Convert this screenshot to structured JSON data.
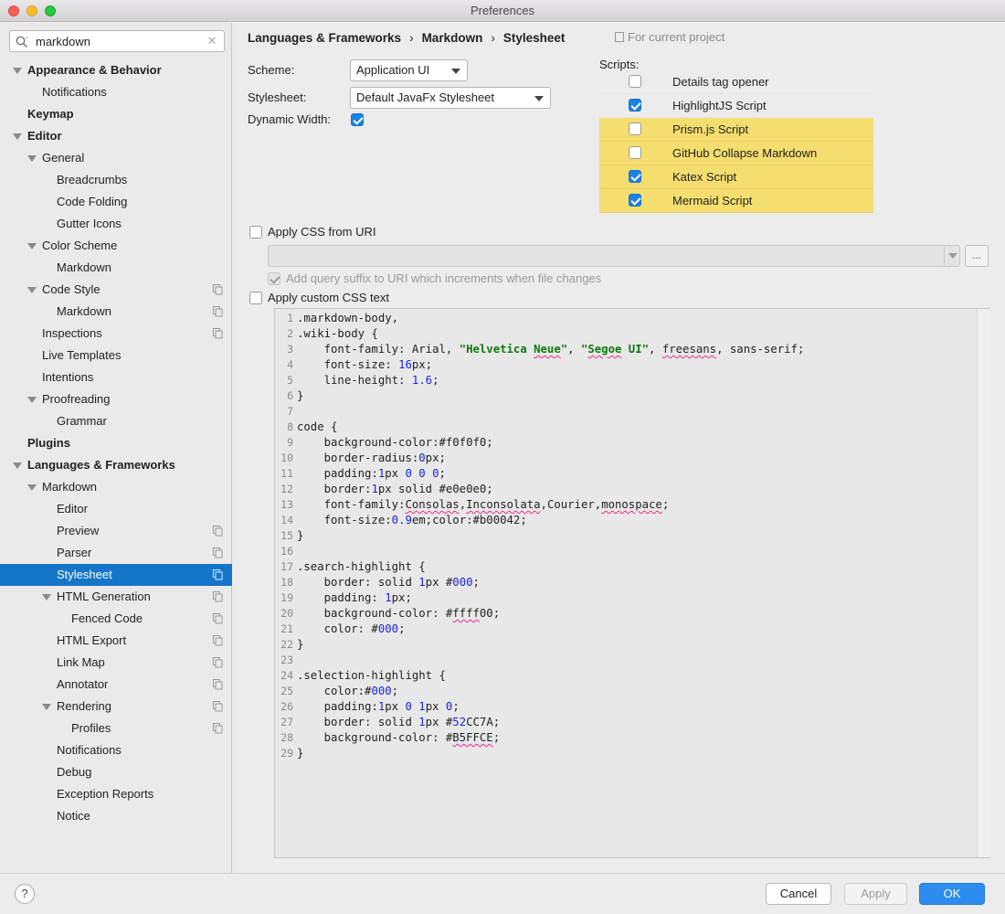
{
  "window": {
    "title": "Preferences"
  },
  "search": {
    "value": "markdown",
    "placeholder": ""
  },
  "sidebar": {
    "items": [
      {
        "label": "Appearance & Behavior",
        "level": 0,
        "bold": true,
        "expanded": true,
        "copy": false
      },
      {
        "label": "Notifications",
        "level": 1,
        "bold": false,
        "copy": false
      },
      {
        "label": "Keymap",
        "level": 0,
        "bold": true,
        "copy": false
      },
      {
        "label": "Editor",
        "level": 0,
        "bold": true,
        "expanded": true,
        "copy": false
      },
      {
        "label": "General",
        "level": 1,
        "bold": false,
        "expanded": true,
        "copy": false
      },
      {
        "label": "Breadcrumbs",
        "level": 2,
        "bold": false,
        "copy": false
      },
      {
        "label": "Code Folding",
        "level": 2,
        "bold": false,
        "copy": false
      },
      {
        "label": "Gutter Icons",
        "level": 2,
        "bold": false,
        "copy": false
      },
      {
        "label": "Color Scheme",
        "level": 1,
        "bold": false,
        "expanded": true,
        "copy": false
      },
      {
        "label": "Markdown",
        "level": 2,
        "bold": false,
        "copy": false
      },
      {
        "label": "Code Style",
        "level": 1,
        "bold": false,
        "expanded": true,
        "copy": true
      },
      {
        "label": "Markdown",
        "level": 2,
        "bold": false,
        "copy": true
      },
      {
        "label": "Inspections",
        "level": 1,
        "bold": false,
        "copy": true
      },
      {
        "label": "Live Templates",
        "level": 1,
        "bold": false,
        "copy": false
      },
      {
        "label": "Intentions",
        "level": 1,
        "bold": false,
        "copy": false
      },
      {
        "label": "Proofreading",
        "level": 1,
        "bold": false,
        "expanded": true,
        "copy": false
      },
      {
        "label": "Grammar",
        "level": 2,
        "bold": false,
        "copy": false
      },
      {
        "label": "Plugins",
        "level": 0,
        "bold": true,
        "copy": false
      },
      {
        "label": "Languages & Frameworks",
        "level": 0,
        "bold": true,
        "expanded": true,
        "copy": false
      },
      {
        "label": "Markdown",
        "level": 1,
        "bold": false,
        "expanded": true,
        "copy": false
      },
      {
        "label": "Editor",
        "level": 2,
        "bold": false,
        "copy": false
      },
      {
        "label": "Preview",
        "level": 2,
        "bold": false,
        "copy": true
      },
      {
        "label": "Parser",
        "level": 2,
        "bold": false,
        "copy": true
      },
      {
        "label": "Stylesheet",
        "level": 2,
        "bold": false,
        "copy": true,
        "selected": true
      },
      {
        "label": "HTML Generation",
        "level": 2,
        "bold": false,
        "expanded": true,
        "copy": true
      },
      {
        "label": "Fenced Code",
        "level": 3,
        "bold": false,
        "copy": true
      },
      {
        "label": "HTML Export",
        "level": 2,
        "bold": false,
        "copy": true
      },
      {
        "label": "Link Map",
        "level": 2,
        "bold": false,
        "copy": true
      },
      {
        "label": "Annotator",
        "level": 2,
        "bold": false,
        "copy": true
      },
      {
        "label": "Rendering",
        "level": 2,
        "bold": false,
        "expanded": true,
        "copy": true
      },
      {
        "label": "Profiles",
        "level": 3,
        "bold": false,
        "copy": true
      },
      {
        "label": "Notifications",
        "level": 2,
        "bold": false,
        "copy": false
      },
      {
        "label": "Debug",
        "level": 2,
        "bold": false,
        "copy": false
      },
      {
        "label": "Exception Reports",
        "level": 2,
        "bold": false,
        "copy": false
      },
      {
        "label": "Notice",
        "level": 2,
        "bold": false,
        "copy": false
      }
    ]
  },
  "breadcrumb": {
    "items": [
      "Languages & Frameworks",
      "Markdown",
      "Stylesheet"
    ],
    "project_hint": "For current project"
  },
  "form": {
    "scheme_label": "Scheme:",
    "scheme_value": "Application UI",
    "stylesheet_label": "Stylesheet:",
    "stylesheet_value": "Default JavaFx Stylesheet",
    "dynamic_width_label": "Dynamic Width:",
    "dynamic_width_checked": true
  },
  "scripts": {
    "label": "Scripts:",
    "highlight_color": "#f4de6f",
    "items": [
      {
        "label": "Details tag opener",
        "checked": false,
        "highlighted": false
      },
      {
        "label": "HighlightJS Script",
        "checked": true,
        "highlighted": false
      },
      {
        "label": "Prism.js Script",
        "checked": false,
        "highlighted": true
      },
      {
        "label": "GitHub Collapse Markdown",
        "checked": false,
        "highlighted": true
      },
      {
        "label": "Katex Script",
        "checked": true,
        "highlighted": true
      },
      {
        "label": "Mermaid Script",
        "checked": true,
        "highlighted": true
      }
    ]
  },
  "css_uri": {
    "apply_label": "Apply CSS from URI",
    "apply_checked": false,
    "uri_value": "",
    "browse_label": "...",
    "suffix_label": "Add query suffix to URI which increments when file changes",
    "suffix_checked": true
  },
  "custom_css": {
    "apply_label": "Apply custom CSS text",
    "apply_checked": false,
    "lines": [
      [
        {
          "t": ".markdown-body,",
          "c": ""
        }
      ],
      [
        {
          "t": ".wiki-body {",
          "c": ""
        }
      ],
      [
        {
          "t": "    font-family: Arial, ",
          "c": ""
        },
        {
          "t": "\"Helvetica ",
          "c": "str"
        },
        {
          "t": "Neue",
          "c": "str typo"
        },
        {
          "t": "\"",
          "c": "str"
        },
        {
          "t": ", ",
          "c": ""
        },
        {
          "t": "\"",
          "c": "str"
        },
        {
          "t": "Segoe",
          "c": "str typo"
        },
        {
          "t": " UI\"",
          "c": "str"
        },
        {
          "t": ", ",
          "c": ""
        },
        {
          "t": "freesans",
          "c": "typo"
        },
        {
          "t": ", sans-serif;",
          "c": ""
        }
      ],
      [
        {
          "t": "    font-size: ",
          "c": ""
        },
        {
          "t": "16",
          "c": "num"
        },
        {
          "t": "px;",
          "c": ""
        }
      ],
      [
        {
          "t": "    line-height: ",
          "c": ""
        },
        {
          "t": "1.6",
          "c": "num"
        },
        {
          "t": ";",
          "c": ""
        }
      ],
      [
        {
          "t": "}",
          "c": ""
        }
      ],
      [
        {
          "t": "",
          "c": ""
        }
      ],
      [
        {
          "t": "code {",
          "c": ""
        }
      ],
      [
        {
          "t": "    background-color:#f0f0f0;",
          "c": ""
        }
      ],
      [
        {
          "t": "    border-radius:",
          "c": ""
        },
        {
          "t": "0",
          "c": "num"
        },
        {
          "t": "px;",
          "c": ""
        }
      ],
      [
        {
          "t": "    padding:",
          "c": ""
        },
        {
          "t": "1",
          "c": "num"
        },
        {
          "t": "px ",
          "c": ""
        },
        {
          "t": "0 0 0",
          "c": "num"
        },
        {
          "t": ";",
          "c": ""
        }
      ],
      [
        {
          "t": "    border:",
          "c": ""
        },
        {
          "t": "1",
          "c": "num"
        },
        {
          "t": "px solid #e0e0e0;",
          "c": ""
        }
      ],
      [
        {
          "t": "    font-family:",
          "c": ""
        },
        {
          "t": "Consolas",
          "c": "typo"
        },
        {
          "t": ",",
          "c": ""
        },
        {
          "t": "Inconsolata",
          "c": "typo"
        },
        {
          "t": ",Courier,",
          "c": ""
        },
        {
          "t": "monospace",
          "c": "typo"
        },
        {
          "t": ";",
          "c": ""
        }
      ],
      [
        {
          "t": "    font-size:",
          "c": ""
        },
        {
          "t": "0.9",
          "c": "num"
        },
        {
          "t": "em;color:#b00042;",
          "c": ""
        }
      ],
      [
        {
          "t": "}",
          "c": ""
        }
      ],
      [
        {
          "t": "",
          "c": ""
        }
      ],
      [
        {
          "t": ".search-highlight {",
          "c": ""
        }
      ],
      [
        {
          "t": "    border: solid ",
          "c": ""
        },
        {
          "t": "1",
          "c": "num"
        },
        {
          "t": "px #",
          "c": ""
        },
        {
          "t": "000",
          "c": "num"
        },
        {
          "t": ";",
          "c": ""
        }
      ],
      [
        {
          "t": "    padding: ",
          "c": ""
        },
        {
          "t": "1",
          "c": "num"
        },
        {
          "t": "px;",
          "c": ""
        }
      ],
      [
        {
          "t": "    background-color: #",
          "c": ""
        },
        {
          "t": "ffff",
          "c": "typo"
        },
        {
          "t": "00;",
          "c": ""
        }
      ],
      [
        {
          "t": "    color: #",
          "c": ""
        },
        {
          "t": "000",
          "c": "num"
        },
        {
          "t": ";",
          "c": ""
        }
      ],
      [
        {
          "t": "}",
          "c": ""
        }
      ],
      [
        {
          "t": "",
          "c": ""
        }
      ],
      [
        {
          "t": ".selection-highlight {",
          "c": ""
        }
      ],
      [
        {
          "t": "    color:#",
          "c": ""
        },
        {
          "t": "000",
          "c": "num"
        },
        {
          "t": ";",
          "c": ""
        }
      ],
      [
        {
          "t": "    padding:",
          "c": ""
        },
        {
          "t": "1",
          "c": "num"
        },
        {
          "t": "px ",
          "c": ""
        },
        {
          "t": "0 1",
          "c": "num"
        },
        {
          "t": "px ",
          "c": ""
        },
        {
          "t": "0",
          "c": "num"
        },
        {
          "t": ";",
          "c": ""
        }
      ],
      [
        {
          "t": "    border: solid ",
          "c": ""
        },
        {
          "t": "1",
          "c": "num"
        },
        {
          "t": "px #",
          "c": ""
        },
        {
          "t": "52",
          "c": "num"
        },
        {
          "t": "CC7A;",
          "c": ""
        }
      ],
      [
        {
          "t": "    background-color: #",
          "c": ""
        },
        {
          "t": "B5FFCE",
          "c": "typo"
        },
        {
          "t": ";",
          "c": ""
        }
      ],
      [
        {
          "t": "}",
          "c": ""
        }
      ]
    ]
  },
  "buttons": {
    "help": "?",
    "cancel": "Cancel",
    "apply": "Apply",
    "ok": "OK"
  },
  "colors": {
    "accent": "#1576c9",
    "ok_button": "#2d8cf0",
    "highlight": "#f4de6f"
  }
}
